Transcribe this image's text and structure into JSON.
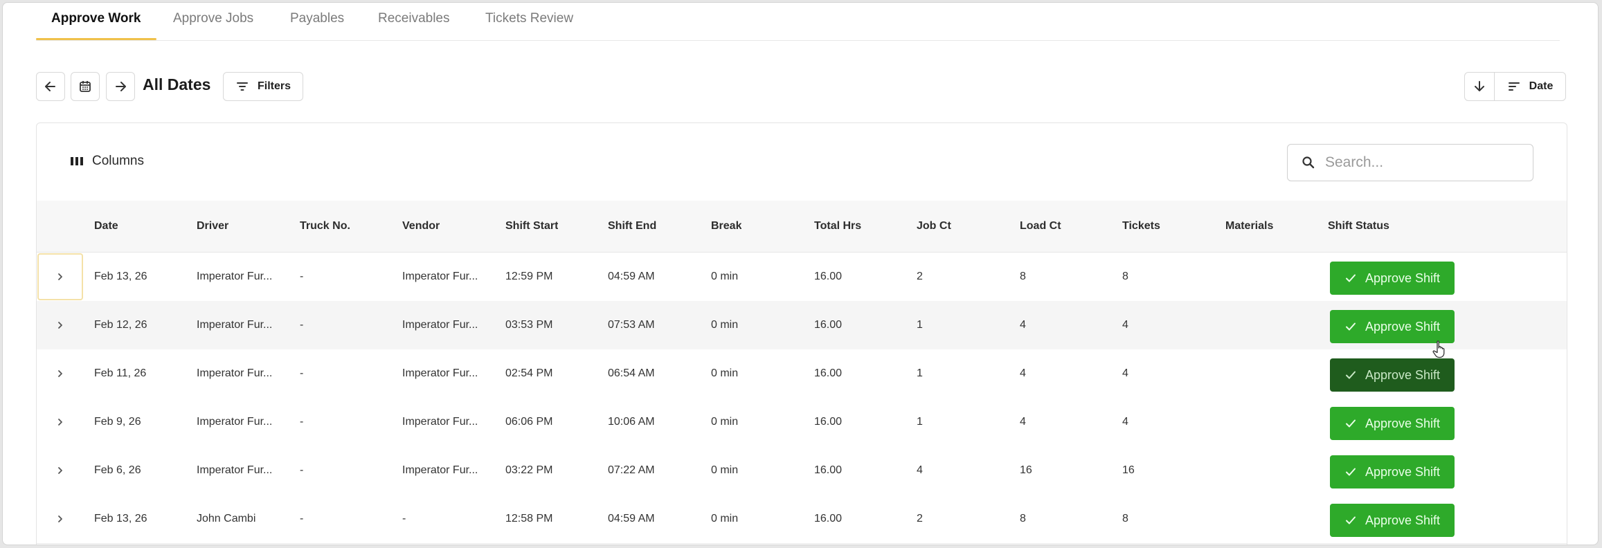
{
  "tabs": [
    {
      "label": "Approve Work",
      "active": true
    },
    {
      "label": "Approve Jobs"
    },
    {
      "label": "Payables"
    },
    {
      "label": "Receivables"
    },
    {
      "label": "Tickets Review"
    }
  ],
  "toolbar": {
    "date_range_label": "All Dates",
    "filters_label": "Filters",
    "sort_label": "Date",
    "icons": [
      "arrow-left-icon",
      "calendar-icon",
      "arrow-right-icon",
      "filter-icon",
      "arrow-down-icon",
      "sort-lines-icon"
    ]
  },
  "table": {
    "columns_button_label": "Columns",
    "search_placeholder": "Search...",
    "headers": [
      "Date",
      "Driver",
      "Truck No.",
      "Vendor",
      "Shift Start",
      "Shift End",
      "Break",
      "Total Hrs",
      "Job Ct",
      "Load Ct",
      "Tickets",
      "Materials",
      "Shift Status"
    ],
    "rows": [
      {
        "cells": [
          "Feb 13, 26",
          "Imperator Fur...",
          "-",
          "Imperator Fur...",
          "12:59 PM",
          "04:59 AM",
          "0 min",
          "16.00",
          "2",
          "8",
          "8",
          ""
        ],
        "action": "Approve Shift"
      },
      {
        "cells": [
          "Feb 12, 26",
          "Imperator Fur...",
          "-",
          "Imperator Fur...",
          "03:53 PM",
          "07:53 AM",
          "0 min",
          "16.00",
          "1",
          "4",
          "4",
          ""
        ],
        "action": "Approve Shift"
      },
      {
        "cells": [
          "Feb 11, 26",
          "Imperator Fur...",
          "-",
          "Imperator Fur...",
          "02:54 PM",
          "06:54 AM",
          "0 min",
          "16.00",
          "1",
          "4",
          "4",
          ""
        ],
        "action": "Approve Shift"
      },
      {
        "cells": [
          "Feb 9, 26",
          "Imperator Fur...",
          "-",
          "Imperator Fur...",
          "06:06 PM",
          "10:06 AM",
          "0 min",
          "16.00",
          "1",
          "4",
          "4",
          ""
        ],
        "action": "Approve Shift"
      },
      {
        "cells": [
          "Feb 6, 26",
          "Imperator Fur...",
          "-",
          "Imperator Fur...",
          "03:22 PM",
          "07:22 AM",
          "0 min",
          "16.00",
          "4",
          "16",
          "16",
          ""
        ],
        "action": "Approve Shift"
      },
      {
        "cells": [
          "Feb 13, 26",
          "John Cambi",
          "-",
          "-",
          "12:58 PM",
          "04:59 AM",
          "0 min",
          "16.00",
          "2",
          "8",
          "8",
          ""
        ],
        "action": "Approve Shift"
      }
    ]
  },
  "colors": {
    "approve_green": "#2eaa2a",
    "approve_pressed": "#1f5c1d",
    "active_tab_underline": "#f0c14a"
  }
}
